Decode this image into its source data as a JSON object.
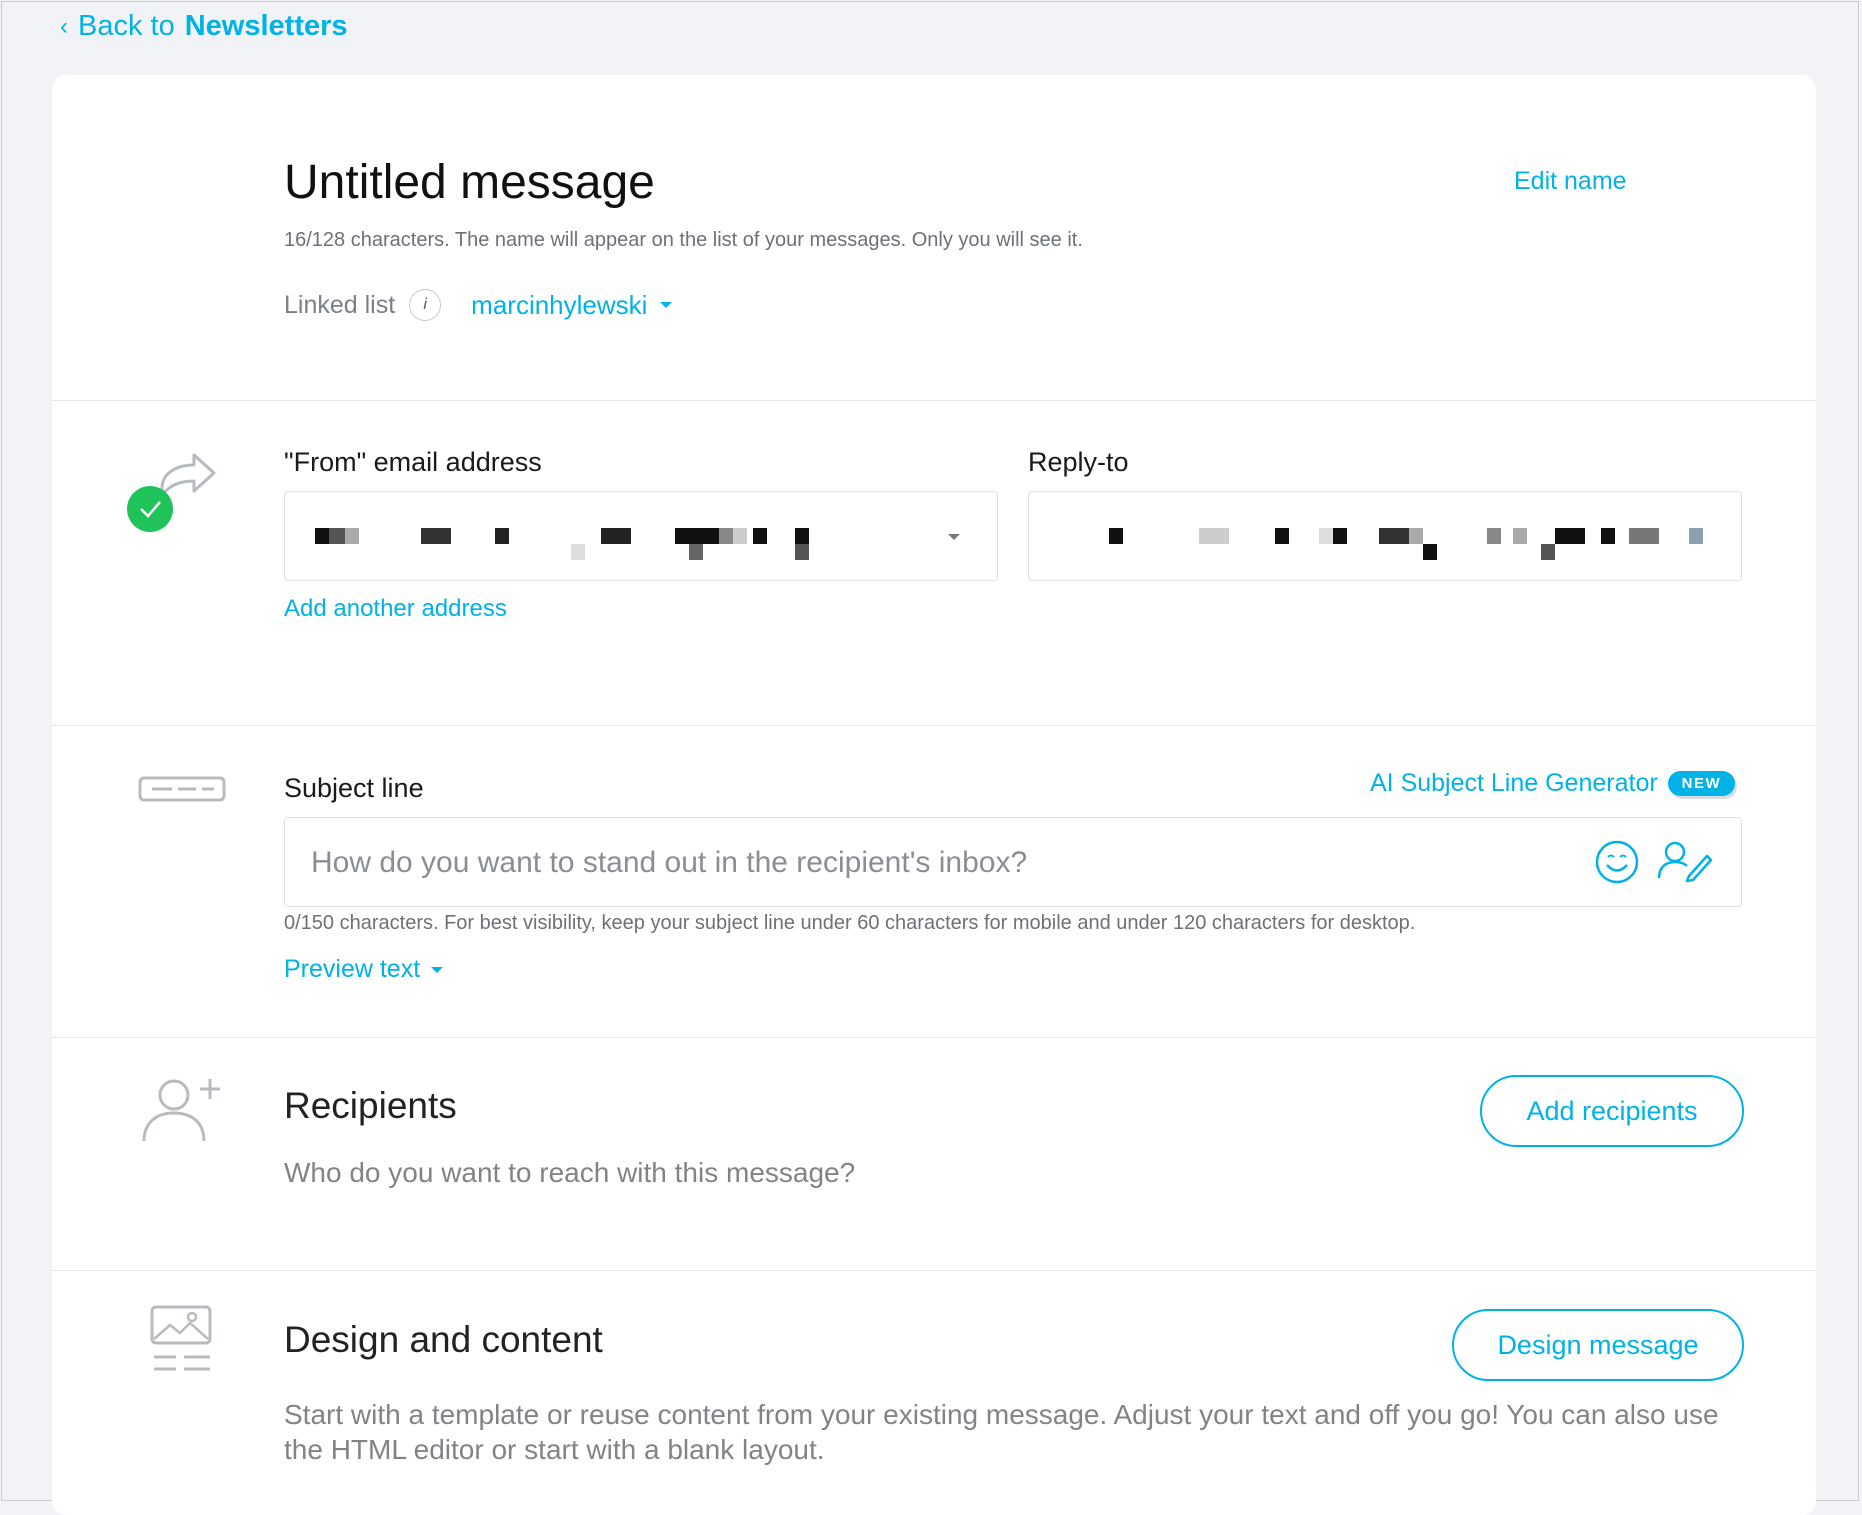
{
  "nav": {
    "back_prefix": "Back to",
    "back_target": "Newsletters"
  },
  "header": {
    "title": "Untitled message",
    "edit_name": "Edit name",
    "char_info": "16/128 characters. The name will appear on the list of your messages. Only you will see it.",
    "linked_list_label": "Linked list",
    "linked_list_value": "marcinhylewski"
  },
  "sender": {
    "from_label": "\"From\" email address",
    "reply_label": "Reply-to",
    "add_address": "Add another address"
  },
  "subject": {
    "label": "Subject line",
    "ai_link": "AI Subject Line Generator",
    "badge": "NEW",
    "placeholder": "How do you want to stand out in the recipient's inbox?",
    "char_info": "0/150 characters. For best visibility, keep your subject line under 60 characters for mobile and under 120 characters for desktop.",
    "preview_text": "Preview text"
  },
  "recipients": {
    "title": "Recipients",
    "description": "Who do you want to reach with this message?",
    "button": "Add recipients"
  },
  "design": {
    "title": "Design and content",
    "description": "Start with a template or reuse content from your existing message. Adjust your text and off you go! You can also use the HTML editor or start with a blank layout.",
    "button": "Design message"
  },
  "colors": {
    "accent": "#00b2e6",
    "success": "#20c35a",
    "icon_gray": "#b7bbc0"
  }
}
